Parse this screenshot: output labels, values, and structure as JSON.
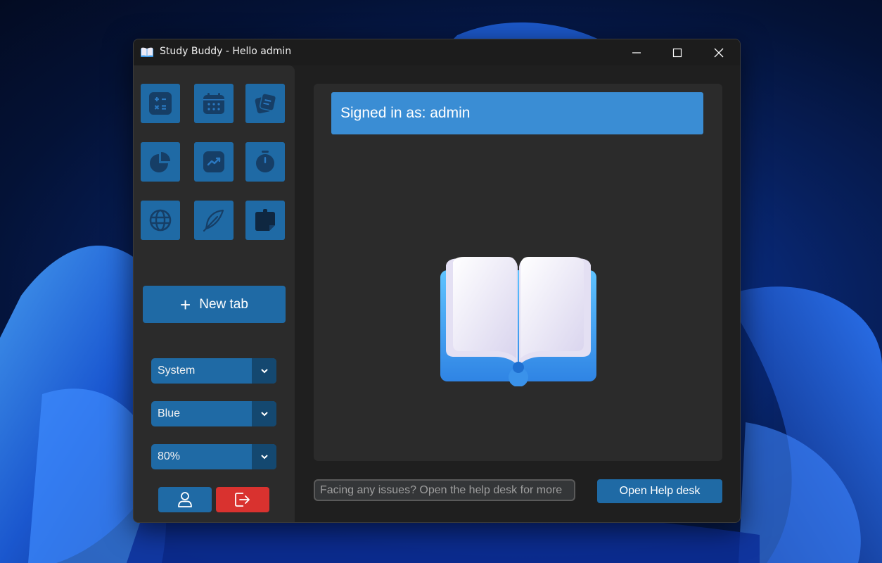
{
  "window": {
    "title": "Study Buddy - Hello admin"
  },
  "sidebar": {
    "tools": [
      {
        "icon": "calculator-icon"
      },
      {
        "icon": "calendar-icon"
      },
      {
        "icon": "flashcards-icon"
      },
      {
        "icon": "pie-chart-icon"
      },
      {
        "icon": "trend-chart-icon"
      },
      {
        "icon": "stopwatch-icon"
      },
      {
        "icon": "globe-icon"
      },
      {
        "icon": "feather-icon"
      },
      {
        "icon": "sticky-note-icon"
      }
    ],
    "new_tab_label": "New tab",
    "appearance_value": "System",
    "theme_value": "Blue",
    "scaling_value": "80%"
  },
  "main": {
    "signed_in_text": "Signed in as: admin",
    "help_placeholder": "Facing any issues? Open the help desk for more",
    "help_button_label": "Open Help desk"
  },
  "colors": {
    "accent": "#1f6aa5",
    "accent_dark": "#144870",
    "banner": "#3a8dd4",
    "logout": "#d9322f",
    "panel": "#2b2b2b",
    "window_bg": "#1f1f1f"
  }
}
